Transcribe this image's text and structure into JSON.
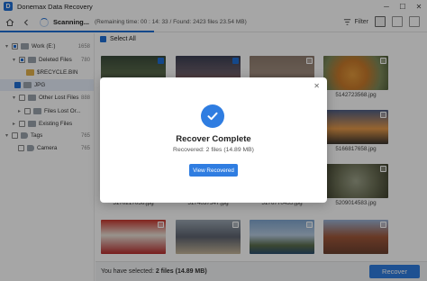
{
  "app": {
    "title": "Donemax Data Recovery",
    "logo_letter": "D"
  },
  "window_controls": {
    "minimize": "─",
    "maximize": "☐",
    "close": "✕"
  },
  "toolbar": {
    "status": "Scanning...",
    "info": "(Remaining time: 00 : 14: 33 / Found: 2423 files 23.54 MB)",
    "filter_label": "Filter",
    "progress_fraction": 0.36
  },
  "sidebar": {
    "items": [
      {
        "label": "Work (E:)",
        "count": "1658",
        "chev": "▾",
        "cb": "partial",
        "icon": "drive"
      },
      {
        "label": "Deleted Files",
        "count": "780",
        "chev": "▾",
        "cb": "partial",
        "icon": "folder"
      },
      {
        "label": "$RECYCLE.BIN",
        "count": "",
        "chev": "",
        "cb": "none",
        "icon": "folder-yellow"
      },
      {
        "label": "JPG",
        "count": "",
        "chev": "",
        "cb": "checked",
        "icon": "folder",
        "selected": true
      },
      {
        "label": "Other Lost Files",
        "count": "888",
        "chev": "▾",
        "cb": "none",
        "icon": "folder"
      },
      {
        "label": "Files Lost Or...",
        "count": "",
        "chev": "▸",
        "cb": "none",
        "icon": "folder"
      },
      {
        "label": "Existing Files",
        "count": "",
        "chev": "▸",
        "cb": "none",
        "icon": "folder"
      },
      {
        "label": "Tags",
        "count": "765",
        "chev": "▾",
        "cb": "none",
        "icon": "tag"
      },
      {
        "label": "Camera",
        "count": "765",
        "chev": "",
        "cb": "none",
        "icon": "tag"
      }
    ]
  },
  "main": {
    "select_all_label": "Select All",
    "files": [
      {
        "name": "",
        "checked": true,
        "bg": "linear-gradient(180deg,#3a4a3a 0%,#5a6b4c 50%,#2c2c2c 100%)"
      },
      {
        "name": "",
        "checked": true,
        "bg": "linear-gradient(180deg,#3a3f52 0%,#6b5e6a 50%,#8a4c3c 100%)"
      },
      {
        "name": "",
        "checked": false,
        "bg": "linear-gradient(180deg,#8e7b6e 0%,#a18e80 50%,#5c4a40 100%)"
      },
      {
        "name": "5142723568.jpg",
        "checked": false,
        "bg": "radial-gradient(circle at 45% 55%,#e39a3c 0%,#c97a2a 35%,#7d8a5a 70%,#4f5d3a 100%)"
      },
      {
        "name": "",
        "checked": false,
        "bg": "linear-gradient(180deg,#6b8cc2 0%,#9db6dc 60%,#d9d9d0 100%)"
      },
      {
        "name": "",
        "checked": false,
        "bg": "linear-gradient(180deg,#e0ddd6 0%,#b8b2a8 100%)"
      },
      {
        "name": "",
        "checked": false,
        "bg": "linear-gradient(180deg,#7aa0c8 0%,#b0c8e0 50%,#5d7a52 100%)"
      },
      {
        "name": "5166817658.jpg",
        "checked": false,
        "bg": "linear-gradient(180deg,#4e5e86 0%,#e69a4a 55%,#3a3530 100%)"
      },
      {
        "name": "5170217056.jpg",
        "checked": false,
        "bg": "linear-gradient(180deg,#1e4c6e 0%,#2e6e8c 60%,#9cb7c4 100%)"
      },
      {
        "name": "5174037547.jpg",
        "checked": false,
        "bg": "linear-gradient(180deg,#4a4a44 0%,#7c8c6a 40%,#a0927a 100%)"
      },
      {
        "name": "5176770435.jpg",
        "checked": false,
        "bg": "linear-gradient(180deg,#2a3e58 0%,#516a8a 50%,#c98a52 80%,#2a2a2a 100%)"
      },
      {
        "name": "5209014583.jpg",
        "checked": false,
        "bg": "radial-gradient(circle,#9da28a 0%,#6e7258 50%,#40422e 100%)"
      },
      {
        "name": "",
        "checked": false,
        "bg": "linear-gradient(180deg,#c7372e 0%,#e9e2d8 45%,#b82d2d 100%)"
      },
      {
        "name": "",
        "checked": false,
        "bg": "linear-gradient(180deg,#9ba7b2 0%,#5e6470 50%,#c6b69a 100%)"
      },
      {
        "name": "",
        "checked": false,
        "bg": "linear-gradient(180deg,#7fa6cf 0%,#b7cbe0 45%,#5b6e4c 75%,#2c4f6e 100%)"
      },
      {
        "name": "",
        "checked": false,
        "bg": "linear-gradient(180deg,#9bb4d6 0%,#a0583a 50%,#6b4030 100%)"
      }
    ]
  },
  "dialog": {
    "close": "✕",
    "title": "Recover Complete",
    "subtitle": "Recovered: 2 files (14.89 MB)",
    "button_label": "View Recovered"
  },
  "bottom": {
    "selected_prefix": "You have selected: ",
    "selected_value": "2 files (14.89 MB)",
    "recover_label": "Recover"
  },
  "colors": {
    "accent": "#2f7de1",
    "brand": "#1f6fd6"
  }
}
